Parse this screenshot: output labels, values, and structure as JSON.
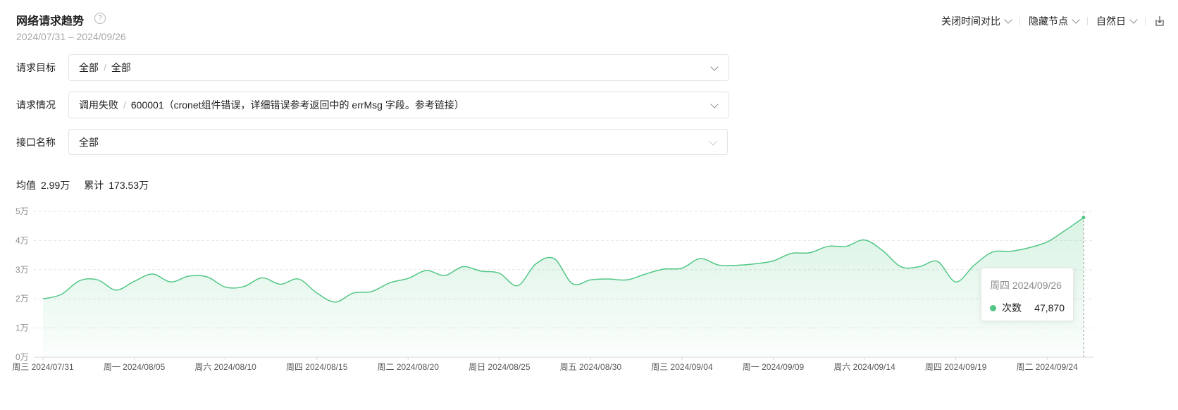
{
  "header": {
    "title": "网络请求趋势",
    "help": "?",
    "date_range": "2024/07/31 – 2024/09/26"
  },
  "controls": {
    "compare": "关闭时间对比",
    "hide_nodes": "隐藏节点",
    "granularity": "自然日"
  },
  "filters": {
    "target": {
      "label": "请求目标",
      "part1": "全部",
      "part2": "全部"
    },
    "status": {
      "label": "请求情况",
      "part1": "调用失败",
      "part2": "600001（cronet组件错误，详细错误参考返回中的 errMsg 字段。参考链接）"
    },
    "api": {
      "label": "接口名称",
      "value": "全部"
    }
  },
  "stats": {
    "avg_label": "均值",
    "avg_value": "2.99万",
    "total_label": "累计",
    "total_value": "173.53万"
  },
  "tooltip": {
    "title": "周四 2024/09/26",
    "series_name": "次数",
    "value": "47,870"
  },
  "colors": {
    "line": "#52c785",
    "fill": "#52c785",
    "grid": "#e6e6e6"
  },
  "chart_data": {
    "type": "area",
    "xlabels": [
      "周三 2024/07/31",
      "周一 2024/08/05",
      "周六 2024/08/10",
      "周四 2024/08/15",
      "周二 2024/08/20",
      "周日 2024/08/25",
      "周五 2024/08/30",
      "周三 2024/09/04",
      "周一 2024/09/09",
      "周六 2024/09/14",
      "周四 2024/09/19",
      "周二 2024/09/24"
    ],
    "yticks": [
      "0万",
      "1万",
      "2万",
      "3万",
      "4万",
      "5万"
    ],
    "ylim": [
      0,
      50000
    ],
    "x": [
      "07/31",
      "08/01",
      "08/02",
      "08/03",
      "08/04",
      "08/05",
      "08/06",
      "08/07",
      "08/08",
      "08/09",
      "08/10",
      "08/11",
      "08/12",
      "08/13",
      "08/14",
      "08/15",
      "08/16",
      "08/17",
      "08/18",
      "08/19",
      "08/20",
      "08/21",
      "08/22",
      "08/23",
      "08/24",
      "08/25",
      "08/26",
      "08/27",
      "08/28",
      "08/29",
      "08/30",
      "08/31",
      "09/01",
      "09/02",
      "09/03",
      "09/04",
      "09/05",
      "09/06",
      "09/07",
      "09/08",
      "09/09",
      "09/10",
      "09/11",
      "09/12",
      "09/13",
      "09/14",
      "09/15",
      "09/16",
      "09/17",
      "09/18",
      "09/19",
      "09/20",
      "09/21",
      "09/22",
      "09/23",
      "09/24",
      "09/25",
      "09/26"
    ],
    "series": [
      {
        "values": [
          20000,
          21500,
          26200,
          26500,
          23000,
          26000,
          28500,
          25800,
          27800,
          27500,
          24000,
          24200,
          27200,
          25000,
          26800,
          22000,
          18900,
          22000,
          22500,
          25500,
          27000,
          29700,
          28000,
          31000,
          29500,
          28800,
          24500,
          32000,
          33800,
          25200,
          26500,
          26800,
          26500,
          28500,
          30200,
          30500,
          33800,
          31600,
          31500,
          32000,
          33000,
          35600,
          35800,
          38000,
          38000,
          40200,
          36500,
          31000,
          31000,
          32800,
          25800,
          31500,
          36000,
          36300,
          37500,
          39500,
          43500,
          47870
        ]
      }
    ]
  }
}
